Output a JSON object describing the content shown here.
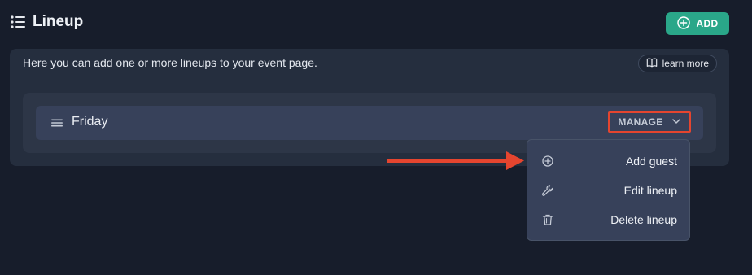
{
  "header": {
    "title": "Lineup",
    "add_button_label": "ADD"
  },
  "panel": {
    "intro_text": "Here you can add one or more lineups to your event page.",
    "learn_more_label": "learn more"
  },
  "lineups": [
    {
      "name": "Friday",
      "manage_label": "MANAGE"
    }
  ],
  "manage_menu": {
    "items": [
      {
        "label": "Add guest",
        "icon": "plus-circle-icon"
      },
      {
        "label": "Edit lineup",
        "icon": "wrench-icon"
      },
      {
        "label": "Delete lineup",
        "icon": "trash-icon"
      }
    ]
  },
  "colors": {
    "background": "#171d2b",
    "panel": "#252e3e",
    "accent_green": "#2aa789",
    "highlight_red": "#e5452f"
  }
}
